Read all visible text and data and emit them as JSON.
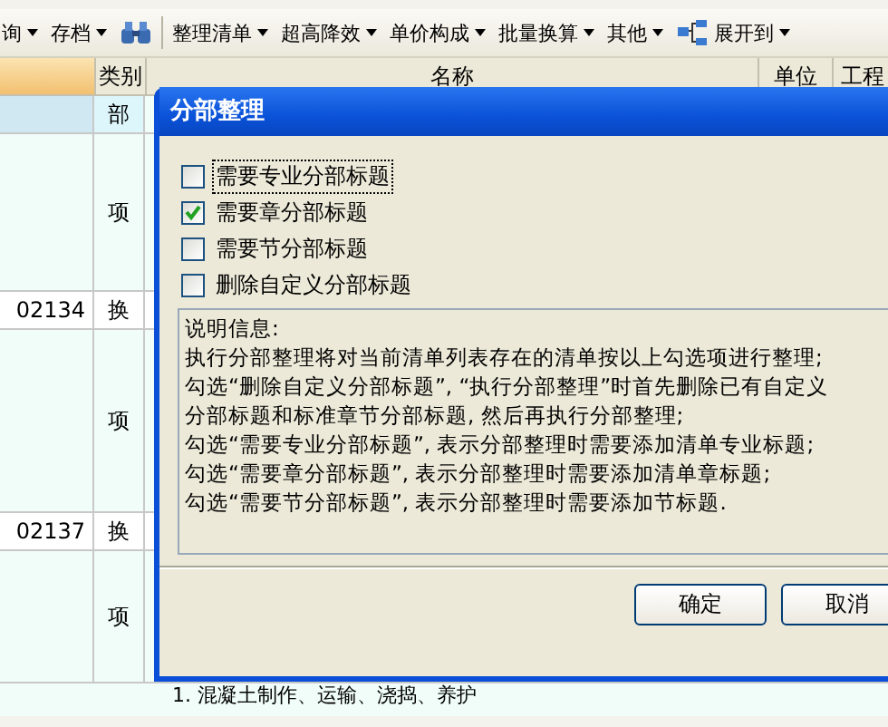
{
  "toolbar": [
    {
      "kind": "menu",
      "label": "询"
    },
    {
      "kind": "menu",
      "label": "存档"
    },
    {
      "kind": "search"
    },
    {
      "kind": "menu",
      "label": "整理清单"
    },
    {
      "kind": "menu",
      "label": "超高降效"
    },
    {
      "kind": "menu",
      "label": "单价构成"
    },
    {
      "kind": "menu",
      "label": "批量换算"
    },
    {
      "kind": "menu",
      "label": "其他"
    },
    {
      "kind": "expand",
      "label": "展开到"
    }
  ],
  "table": {
    "columns": [
      "类别",
      "名称",
      "单位",
      "工程"
    ],
    "rows": [
      {
        "kind": "section",
        "code": "",
        "type": "部",
        "selected": true
      },
      {
        "kind": "item",
        "code": "",
        "type": "项",
        "selected": false
      },
      {
        "kind": "sub",
        "code": "02134",
        "type": "换",
        "selected": false
      },
      {
        "kind": "item",
        "code": "",
        "type": "项",
        "selected": false
      },
      {
        "kind": "sub",
        "code": "02137",
        "type": "换",
        "selected": false
      },
      {
        "kind": "item",
        "code": "",
        "type": "项",
        "selected": false
      }
    ],
    "footer_text": "1. 混凝土制作、运输、浇捣、养护"
  },
  "dialog": {
    "title": "分部整理",
    "options": [
      {
        "label": "需要专业分部标题",
        "checked": false,
        "focused": true
      },
      {
        "label": "需要章分部标题",
        "checked": true,
        "focused": false
      },
      {
        "label": "需要节分部标题",
        "checked": false,
        "focused": false
      },
      {
        "label": "删除自定义分部标题",
        "checked": false,
        "focused": false
      }
    ],
    "info_lines": [
      "说明信息:",
      "执行分部整理将对当前清单列表存在的清单按以上勾选项进行整理;",
      "勾选“删除自定义分部标题”, “执行分部整理”时首先删除已有自定义",
      "分部标题和标准章节分部标题, 然后再执行分部整理;",
      "勾选“需要专业分部标题”, 表示分部整理时需要添加清单专业标题;",
      "勾选“需要章分部标题”, 表示分部整理时需要添加清单章标题;",
      "勾选“需要节分部标题”, 表示分部整理时需要添加节标题."
    ],
    "buttons": [
      "确定",
      "取消"
    ]
  }
}
